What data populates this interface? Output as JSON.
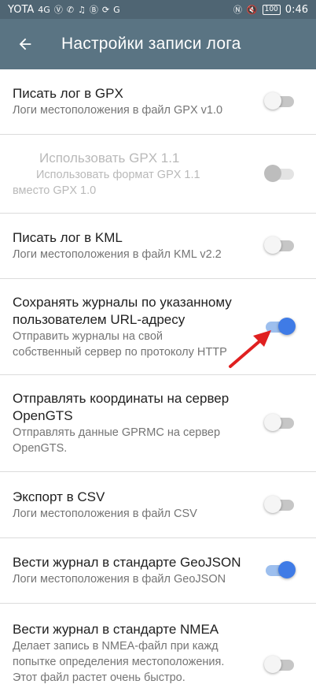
{
  "status_bar": {
    "carrier": "YOTA",
    "signal": "4G",
    "time": "0:46",
    "battery": "100",
    "left_icons": [
      "v-icon",
      "phone-icon",
      "bell-icon",
      "b-icon",
      "sync-icon",
      "g-icon"
    ],
    "right_icons": [
      "nfc-icon",
      "mute-icon"
    ]
  },
  "app_bar": {
    "title": "Настройки записи лога",
    "back_icon": "arrow-left-icon",
    "color": "#5a7483"
  },
  "settings": [
    {
      "title": "Писать лог в GPX",
      "summary": "Логи местоположения в файл GPX v1.0",
      "checked": false,
      "enabled": true
    },
    {
      "title": "Использовать GPX 1.1",
      "summary_line1": "Использовать формат GPX 1.1",
      "summary_line2": "вместо GPX 1.0",
      "checked": false,
      "enabled": false
    },
    {
      "title": "Писать лог в KML",
      "summary": "Логи местоположения в файл KML v2.2",
      "checked": false,
      "enabled": true
    },
    {
      "title_line1": "Сохранять журналы по указанному",
      "title_line2": "пользователем URL-адресу",
      "summary_line1": "Отправить журналы на свой",
      "summary_line2": "собственный сервер по протоколу HTTP",
      "checked": true,
      "enabled": true
    },
    {
      "title_line1": "Отправлять координаты на сервер",
      "title_line2": "OpenGTS",
      "summary_line1": "Отправлять данные GPRMC на сервер",
      "summary_line2": "OpenGTS.",
      "checked": false,
      "enabled": true
    },
    {
      "title": "Экспорт в CSV",
      "summary": "Логи местоположения в файл CSV",
      "checked": false,
      "enabled": true
    },
    {
      "title": "Вести журнал в стандарте GeoJSON",
      "summary": "Логи местоположения в файл GeoJSON",
      "checked": true,
      "enabled": true
    },
    {
      "title": "Вести журнал в стандарте NMEA",
      "summary_line1": "Делает запись в NMEA-файл при кажд",
      "summary_line2": "попытке определения местоположения.",
      "summary_line3": "Этот файл растет очень быстро.",
      "checked": false,
      "enabled": true
    }
  ],
  "colors": {
    "accent": "#3f7be6",
    "annotation_arrow": "#e02020"
  }
}
